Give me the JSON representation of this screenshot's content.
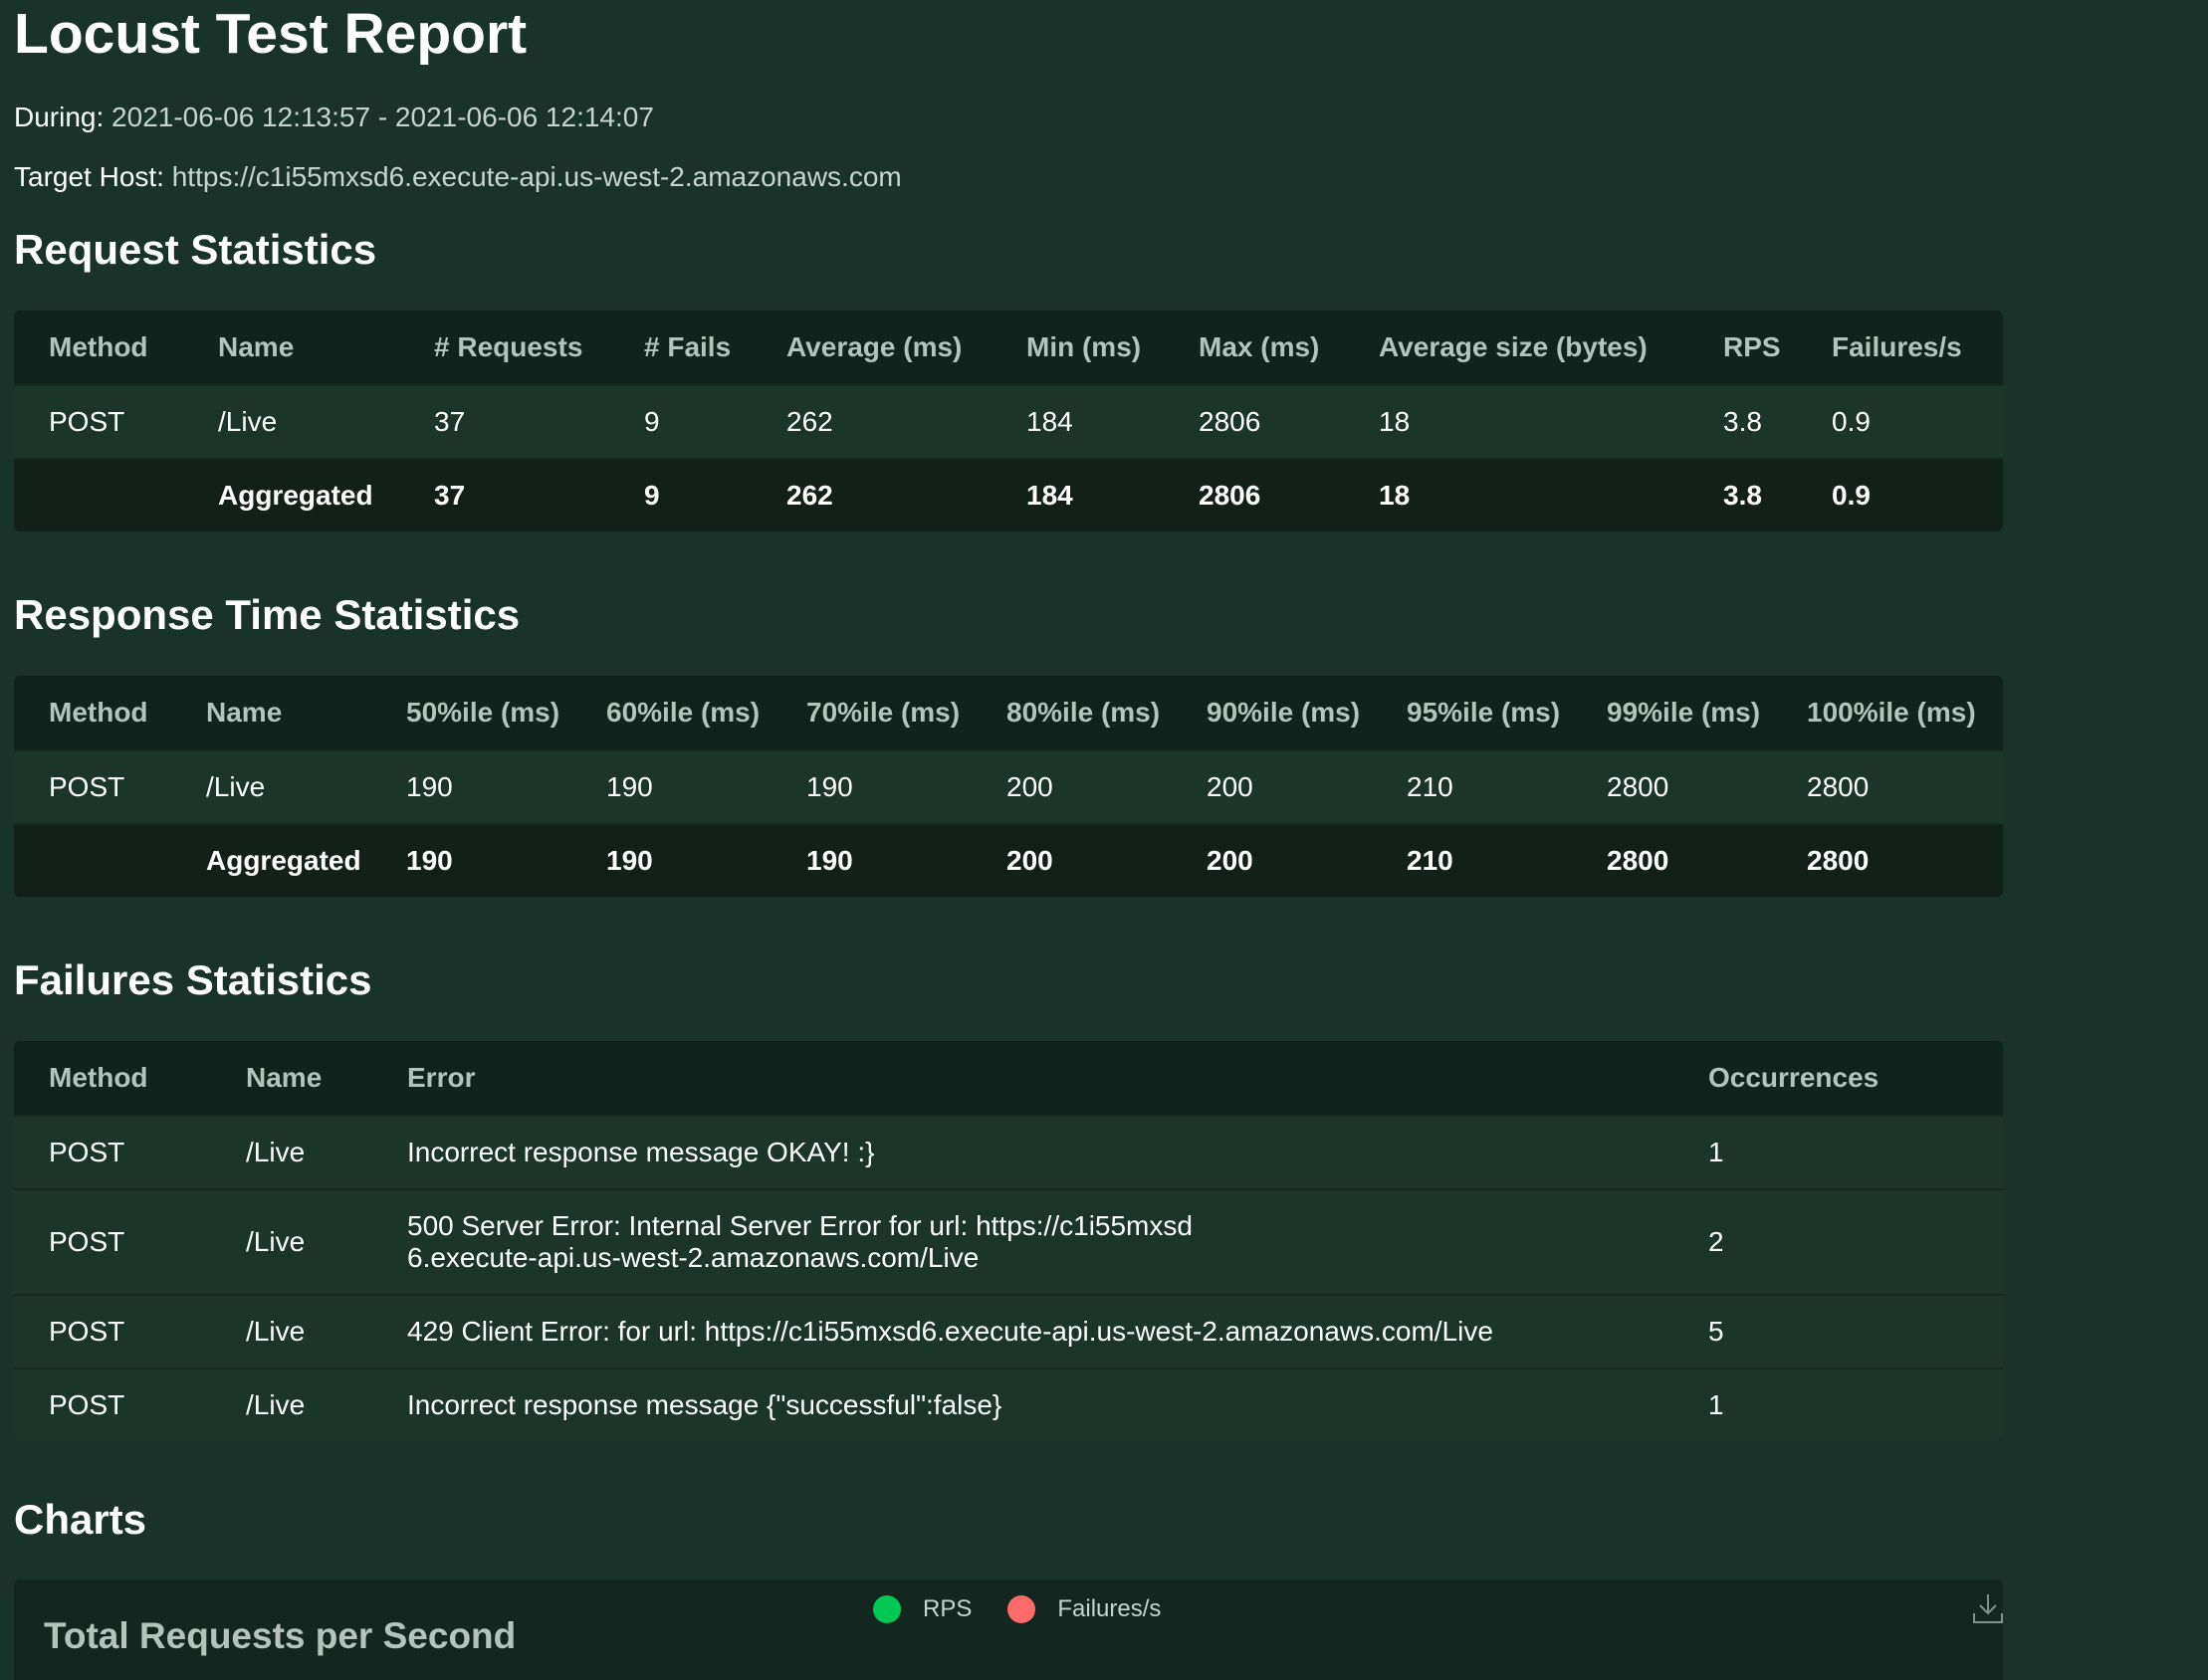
{
  "header": {
    "title": "Locust Test Report",
    "during_label": "During:",
    "during_value": "2021-06-06 12:13:57 - 2021-06-06 12:14:07",
    "host_label": "Target Host:",
    "host_value": "https://c1i55mxsd6.execute-api.us-west-2.amazonaws.com"
  },
  "request_stats": {
    "title": "Request Statistics",
    "columns": [
      "Method",
      "Name",
      "# Requests",
      "# Fails",
      "Average (ms)",
      "Min (ms)",
      "Max (ms)",
      "Average size (bytes)",
      "RPS",
      "Failures/s"
    ],
    "rows": [
      [
        "POST",
        "/Live",
        "37",
        "9",
        "262",
        "184",
        "2806",
        "18",
        "3.8",
        "0.9"
      ]
    ],
    "aggregated": [
      "",
      "Aggregated",
      "37",
      "9",
      "262",
      "184",
      "2806",
      "18",
      "3.8",
      "0.9"
    ]
  },
  "response_stats": {
    "title": "Response Time Statistics",
    "columns": [
      "Method",
      "Name",
      "50%ile (ms)",
      "60%ile (ms)",
      "70%ile (ms)",
      "80%ile (ms)",
      "90%ile (ms)",
      "95%ile (ms)",
      "99%ile (ms)",
      "100%ile (ms)"
    ],
    "rows": [
      [
        "POST",
        "/Live",
        "190",
        "190",
        "190",
        "200",
        "200",
        "210",
        "2800",
        "2800"
      ]
    ],
    "aggregated": [
      "",
      "Aggregated",
      "190",
      "190",
      "190",
      "200",
      "200",
      "210",
      "2800",
      "2800"
    ]
  },
  "failure_stats": {
    "title": "Failures Statistics",
    "columns": [
      "Method",
      "Name",
      "Error",
      "Occurrences"
    ],
    "rows": [
      [
        "POST",
        "/Live",
        "Incorrect response message OKAY! :}",
        "1"
      ],
      [
        "POST",
        "/Live",
        "500 Server Error: Internal Server Error for url: https://c1i55mxsd6.execute-api.us-west-2.amazonaws.com/Live",
        "2"
      ],
      [
        "POST",
        "/Live",
        "429 Client Error: for url: https://c1i55mxsd6.execute-api.us-west-2.amazonaws.com/Live",
        "5"
      ],
      [
        "POST",
        "/Live",
        "Incorrect response message {\"successful\":false}",
        "1"
      ]
    ]
  },
  "charts": {
    "title": "Charts",
    "chart_title": "Total Requests per Second",
    "legend": [
      {
        "label": "RPS",
        "color": "#00c853"
      },
      {
        "label": "Failures/s",
        "color": "#ff6b6b"
      }
    ],
    "download_icon": "download-icon"
  }
}
